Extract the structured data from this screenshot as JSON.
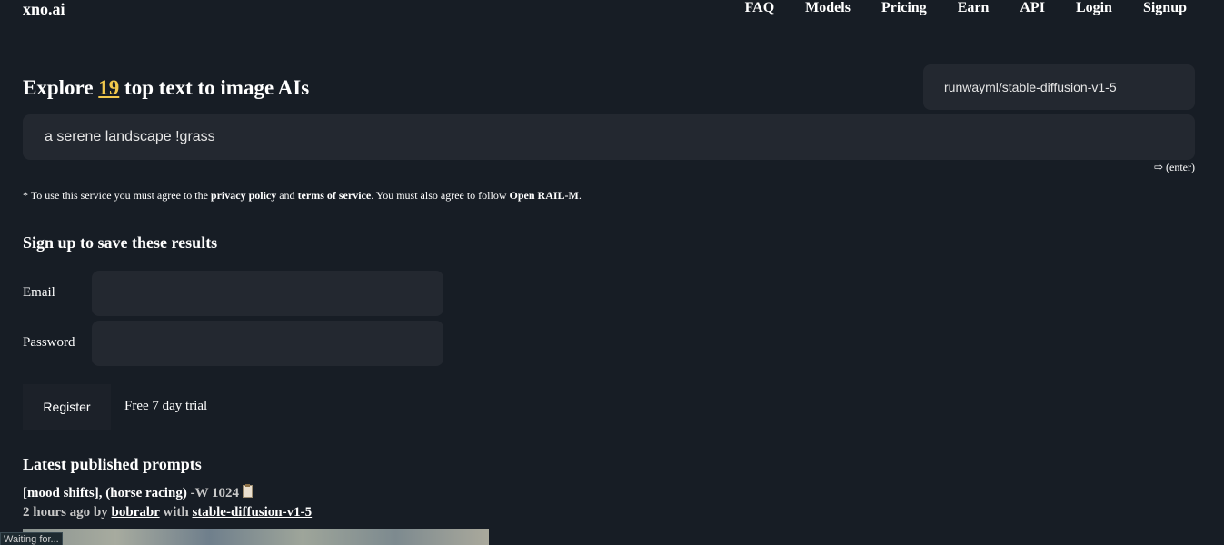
{
  "header": {
    "logo": "xno.ai",
    "nav": [
      "FAQ",
      "Models",
      "Pricing",
      "Earn",
      "API",
      "Login",
      "Signup"
    ]
  },
  "hero": {
    "prefix": "Explore ",
    "count": "19",
    "suffix": " top text to image AIs",
    "model": "runwayml/stable-diffusion-v1-5",
    "prompt_value": "a serene landscape !grass",
    "enter_hint": "⇨ (enter)"
  },
  "terms": {
    "t1": "* To use this service you must agree to the ",
    "privacy": "privacy policy",
    "t2": " and ",
    "tos": "terms of service",
    "t3": ". You must also agree to follow ",
    "rail": "Open RAIL-M",
    "t4": "."
  },
  "signup": {
    "title": "Sign up to save these results",
    "email_label": "Email",
    "password_label": "Password",
    "register_label": "Register",
    "trial_text": "Free 7 day trial"
  },
  "latest": {
    "title": "Latest published prompts",
    "prompt_text": "[mood shifts], (horse racing)",
    "prompt_suffix": " -W 1024",
    "time": "2 hours ago by ",
    "user": "bobrabr",
    "with": " with ",
    "model": "stable-diffusion-v1-5"
  },
  "status": "Waiting for..."
}
